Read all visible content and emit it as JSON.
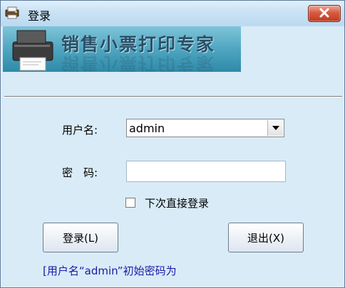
{
  "window": {
    "title": "登录",
    "close_label": "×"
  },
  "banner": {
    "text": "销售小票打印专家"
  },
  "form": {
    "username_label": "用户名:",
    "username_value": "admin",
    "password_label": "密　码:",
    "password_value": "",
    "remember_label": "下次直接登录",
    "remember_checked": false
  },
  "buttons": {
    "login_label": "登录(L)",
    "exit_label": "退出(X)"
  },
  "hint": {
    "text": "[用户名“admin”初始密码为"
  },
  "colors": {
    "window_bg": "#d8ebf7",
    "close_button": "#c83b21",
    "hint_text": "#1a1aa8"
  }
}
